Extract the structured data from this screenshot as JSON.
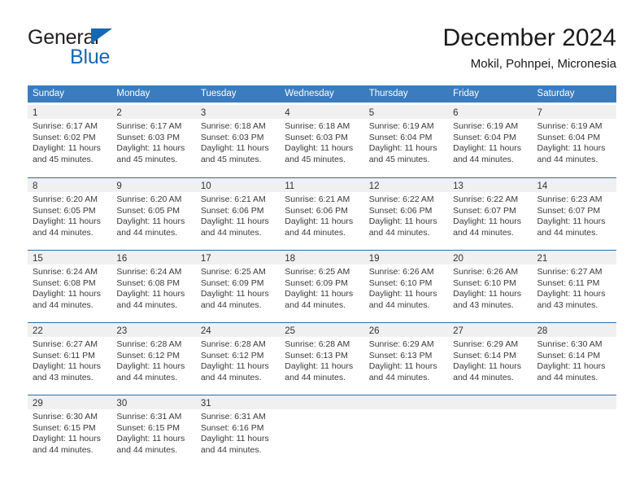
{
  "brand": {
    "name_part1": "General",
    "name_part2": "Blue",
    "logo_icon": "triangle-logo-icon",
    "accent_color": "#1668b3"
  },
  "header": {
    "title": "December 2024",
    "subtitle": "Mokil, Pohnpei, Micronesia"
  },
  "calendar": {
    "header_bg": "#3a7cbe",
    "row_divider_color": "#2e6da4",
    "daynum_band_bg": "#f0f0f0",
    "weekdays": [
      "Sunday",
      "Monday",
      "Tuesday",
      "Wednesday",
      "Thursday",
      "Friday",
      "Saturday"
    ],
    "weeks": [
      [
        {
          "day": "1",
          "lines": [
            "Sunrise: 6:17 AM",
            "Sunset: 6:02 PM",
            "Daylight: 11 hours",
            "and 45 minutes."
          ]
        },
        {
          "day": "2",
          "lines": [
            "Sunrise: 6:17 AM",
            "Sunset: 6:03 PM",
            "Daylight: 11 hours",
            "and 45 minutes."
          ]
        },
        {
          "day": "3",
          "lines": [
            "Sunrise: 6:18 AM",
            "Sunset: 6:03 PM",
            "Daylight: 11 hours",
            "and 45 minutes."
          ]
        },
        {
          "day": "4",
          "lines": [
            "Sunrise: 6:18 AM",
            "Sunset: 6:03 PM",
            "Daylight: 11 hours",
            "and 45 minutes."
          ]
        },
        {
          "day": "5",
          "lines": [
            "Sunrise: 6:19 AM",
            "Sunset: 6:04 PM",
            "Daylight: 11 hours",
            "and 45 minutes."
          ]
        },
        {
          "day": "6",
          "lines": [
            "Sunrise: 6:19 AM",
            "Sunset: 6:04 PM",
            "Daylight: 11 hours",
            "and 44 minutes."
          ]
        },
        {
          "day": "7",
          "lines": [
            "Sunrise: 6:19 AM",
            "Sunset: 6:04 PM",
            "Daylight: 11 hours",
            "and 44 minutes."
          ]
        }
      ],
      [
        {
          "day": "8",
          "lines": [
            "Sunrise: 6:20 AM",
            "Sunset: 6:05 PM",
            "Daylight: 11 hours",
            "and 44 minutes."
          ]
        },
        {
          "day": "9",
          "lines": [
            "Sunrise: 6:20 AM",
            "Sunset: 6:05 PM",
            "Daylight: 11 hours",
            "and 44 minutes."
          ]
        },
        {
          "day": "10",
          "lines": [
            "Sunrise: 6:21 AM",
            "Sunset: 6:06 PM",
            "Daylight: 11 hours",
            "and 44 minutes."
          ]
        },
        {
          "day": "11",
          "lines": [
            "Sunrise: 6:21 AM",
            "Sunset: 6:06 PM",
            "Daylight: 11 hours",
            "and 44 minutes."
          ]
        },
        {
          "day": "12",
          "lines": [
            "Sunrise: 6:22 AM",
            "Sunset: 6:06 PM",
            "Daylight: 11 hours",
            "and 44 minutes."
          ]
        },
        {
          "day": "13",
          "lines": [
            "Sunrise: 6:22 AM",
            "Sunset: 6:07 PM",
            "Daylight: 11 hours",
            "and 44 minutes."
          ]
        },
        {
          "day": "14",
          "lines": [
            "Sunrise: 6:23 AM",
            "Sunset: 6:07 PM",
            "Daylight: 11 hours",
            "and 44 minutes."
          ]
        }
      ],
      [
        {
          "day": "15",
          "lines": [
            "Sunrise: 6:24 AM",
            "Sunset: 6:08 PM",
            "Daylight: 11 hours",
            "and 44 minutes."
          ]
        },
        {
          "day": "16",
          "lines": [
            "Sunrise: 6:24 AM",
            "Sunset: 6:08 PM",
            "Daylight: 11 hours",
            "and 44 minutes."
          ]
        },
        {
          "day": "17",
          "lines": [
            "Sunrise: 6:25 AM",
            "Sunset: 6:09 PM",
            "Daylight: 11 hours",
            "and 44 minutes."
          ]
        },
        {
          "day": "18",
          "lines": [
            "Sunrise: 6:25 AM",
            "Sunset: 6:09 PM",
            "Daylight: 11 hours",
            "and 44 minutes."
          ]
        },
        {
          "day": "19",
          "lines": [
            "Sunrise: 6:26 AM",
            "Sunset: 6:10 PM",
            "Daylight: 11 hours",
            "and 44 minutes."
          ]
        },
        {
          "day": "20",
          "lines": [
            "Sunrise: 6:26 AM",
            "Sunset: 6:10 PM",
            "Daylight: 11 hours",
            "and 43 minutes."
          ]
        },
        {
          "day": "21",
          "lines": [
            "Sunrise: 6:27 AM",
            "Sunset: 6:11 PM",
            "Daylight: 11 hours",
            "and 43 minutes."
          ]
        }
      ],
      [
        {
          "day": "22",
          "lines": [
            "Sunrise: 6:27 AM",
            "Sunset: 6:11 PM",
            "Daylight: 11 hours",
            "and 43 minutes."
          ]
        },
        {
          "day": "23",
          "lines": [
            "Sunrise: 6:28 AM",
            "Sunset: 6:12 PM",
            "Daylight: 11 hours",
            "and 44 minutes."
          ]
        },
        {
          "day": "24",
          "lines": [
            "Sunrise: 6:28 AM",
            "Sunset: 6:12 PM",
            "Daylight: 11 hours",
            "and 44 minutes."
          ]
        },
        {
          "day": "25",
          "lines": [
            "Sunrise: 6:28 AM",
            "Sunset: 6:13 PM",
            "Daylight: 11 hours",
            "and 44 minutes."
          ]
        },
        {
          "day": "26",
          "lines": [
            "Sunrise: 6:29 AM",
            "Sunset: 6:13 PM",
            "Daylight: 11 hours",
            "and 44 minutes."
          ]
        },
        {
          "day": "27",
          "lines": [
            "Sunrise: 6:29 AM",
            "Sunset: 6:14 PM",
            "Daylight: 11 hours",
            "and 44 minutes."
          ]
        },
        {
          "day": "28",
          "lines": [
            "Sunrise: 6:30 AM",
            "Sunset: 6:14 PM",
            "Daylight: 11 hours",
            "and 44 minutes."
          ]
        }
      ],
      [
        {
          "day": "29",
          "lines": [
            "Sunrise: 6:30 AM",
            "Sunset: 6:15 PM",
            "Daylight: 11 hours",
            "and 44 minutes."
          ]
        },
        {
          "day": "30",
          "lines": [
            "Sunrise: 6:31 AM",
            "Sunset: 6:15 PM",
            "Daylight: 11 hours",
            "and 44 minutes."
          ]
        },
        {
          "day": "31",
          "lines": [
            "Sunrise: 6:31 AM",
            "Sunset: 6:16 PM",
            "Daylight: 11 hours",
            "and 44 minutes."
          ]
        },
        {
          "day": "",
          "lines": []
        },
        {
          "day": "",
          "lines": []
        },
        {
          "day": "",
          "lines": []
        },
        {
          "day": "",
          "lines": []
        }
      ]
    ]
  }
}
